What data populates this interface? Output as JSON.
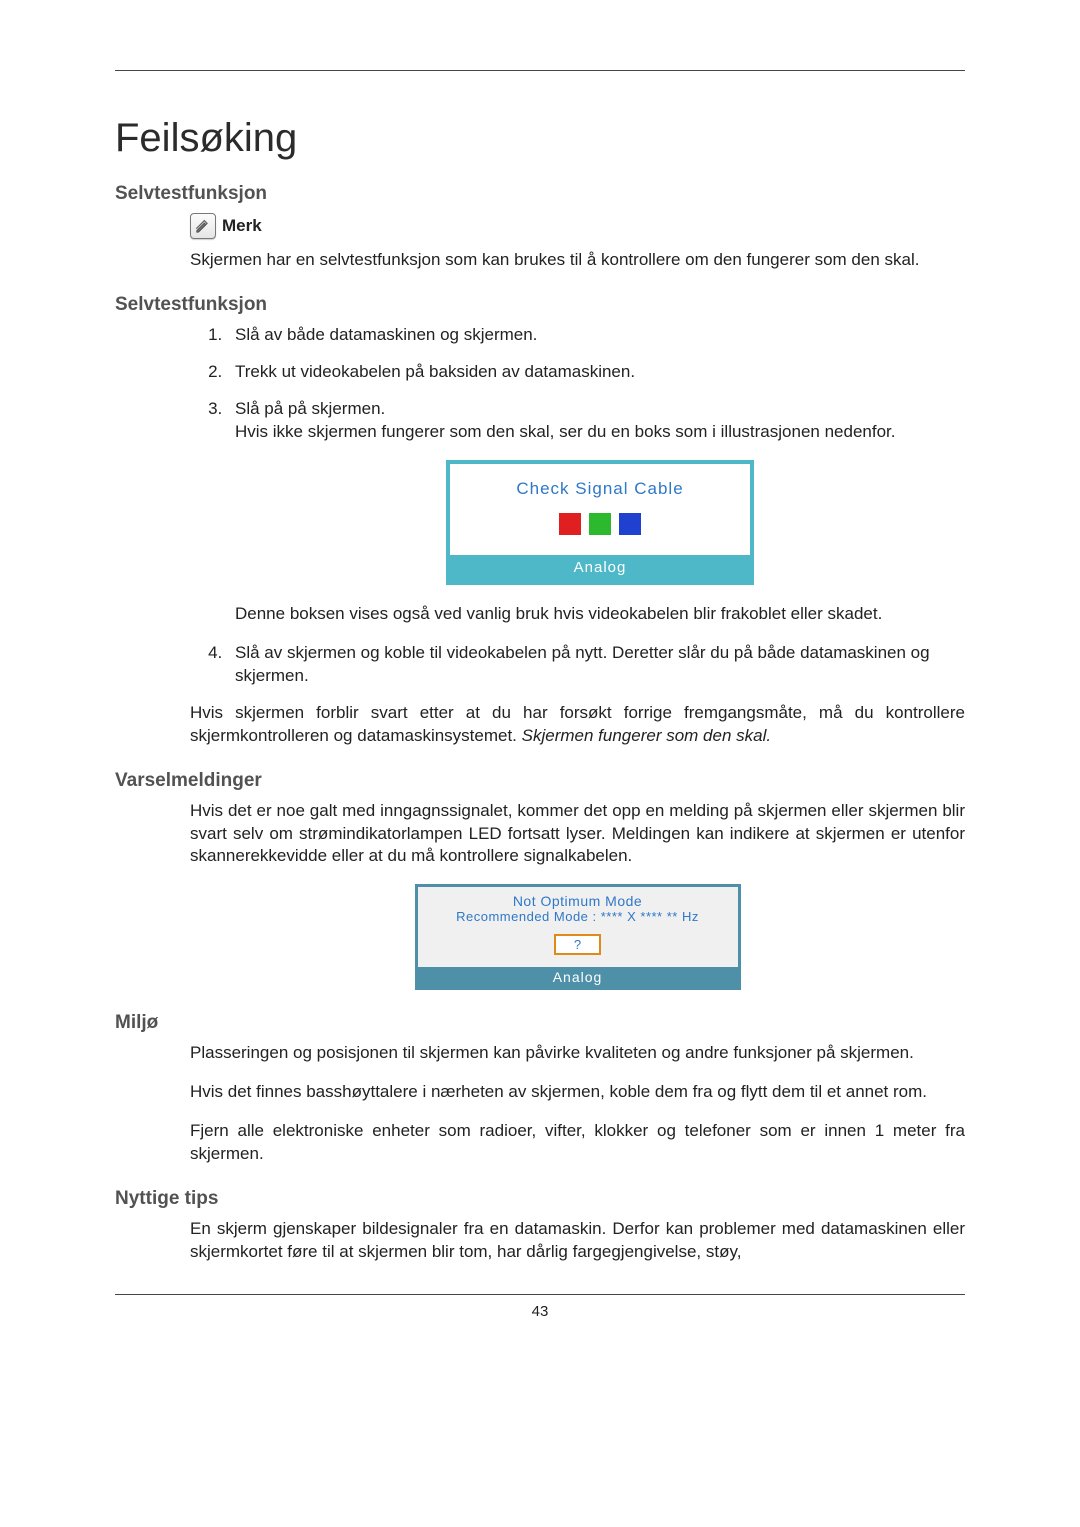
{
  "title": "Feilsøking",
  "section_selftest_a": "Selvtestfunksjon",
  "note_label": "Merk",
  "selftest_intro": "Skjermen har en selvtestfunksjon som kan brukes til å kontrollere om den fungerer som den skal.",
  "section_selftest_b": "Selvtestfunksjon",
  "steps": {
    "s1": "Slå av både datamaskinen og skjermen.",
    "s2": "Trekk ut videokabelen på baksiden av datamaskinen.",
    "s3": "Slå på på skjermen.",
    "s3_sub": "Hvis ikke skjermen fungerer som den skal, ser du en boks som i illustrasjonen nedenfor.",
    "s3_after": "Denne boksen vises også ved vanlig bruk hvis videokabelen blir frakoblet eller skadet.",
    "s4": "Slå av skjermen og koble til videokabelen på nytt. Deretter slår du på både datamaskinen og skjermen."
  },
  "selftest_outro_a": "Hvis skjermen forblir svart etter at du har forsøkt forrige fremgangsmåte, må du kontrollere skjermkontrolleren og datamaskinsystemet. ",
  "selftest_outro_b": "Skjermen fungerer som den skal.",
  "section_warnings": "Varselmeldinger",
  "warnings_body": "Hvis det er noe galt med inngagnssignalet, kommer det opp en melding på skjermen eller skjermen blir svart selv om strømindikatorlampen LED fortsatt lyser. Meldingen kan indikere at skjermen er utenfor skannerekkevidde eller at du må kontrollere signalkabelen.",
  "section_env": "Miljø",
  "env_p1": "Plasseringen og posisjonen til skjermen kan påvirke kvaliteten og andre funksjoner på skjermen.",
  "env_p2": "Hvis det finnes basshøyttalere i nærheten av skjermen, koble dem fra og flytt dem til et annet rom.",
  "env_p3": "Fjern alle elektroniske enheter som radioer, vifter, klokker og telefoner som er innen 1 meter fra skjermen.",
  "section_tips": "Nyttige tips",
  "tips_p1": "En skjerm gjenskaper bildesignaler fra en datamaskin. Derfor kan problemer med datamaskinen eller skjermkortet føre til at skjermen blir tom, har dårlig fargegjengivelse, støy,",
  "osd1": {
    "title": "Check Signal Cable",
    "bar": "Analog"
  },
  "osd2": {
    "line1": "Not Optimum Mode",
    "line2": "Recommended Mode : **** X **** ** Hz",
    "btn": "?",
    "bar": "Analog"
  },
  "page_number": "43"
}
